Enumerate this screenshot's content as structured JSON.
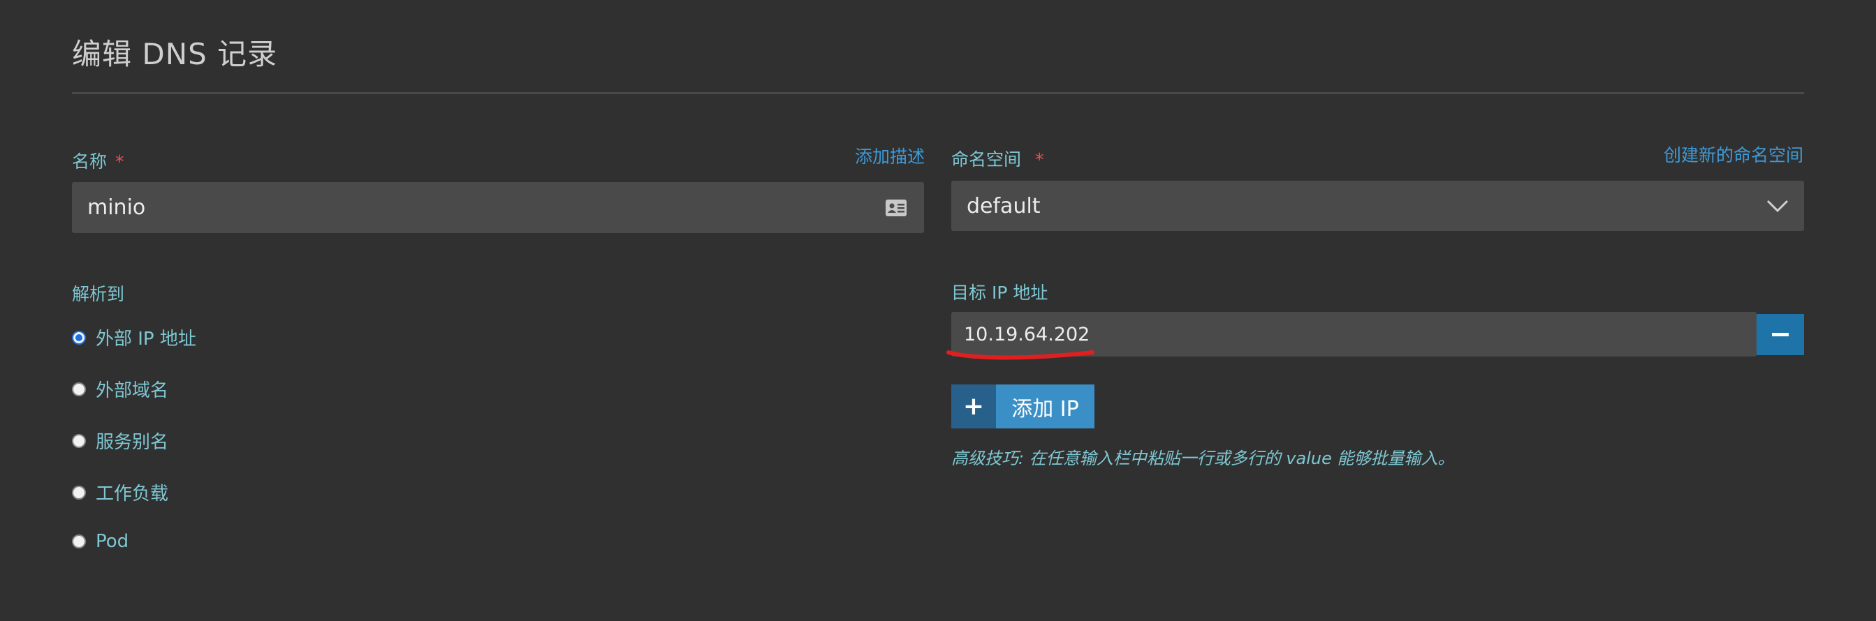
{
  "page": {
    "title": "编辑 DNS 记录"
  },
  "name_field": {
    "label": "名称",
    "required_mark": "*",
    "add_description_link": "添加描述",
    "value": "minio"
  },
  "namespace_field": {
    "label": "命名空间",
    "required_mark": "*",
    "create_link": "创建新的命名空间",
    "value": "default"
  },
  "resolve_to": {
    "label": "解析到",
    "options": [
      {
        "label": "外部 IP 地址",
        "checked": true
      },
      {
        "label": "外部域名",
        "checked": false
      },
      {
        "label": "服务别名",
        "checked": false
      },
      {
        "label": "工作负载",
        "checked": false
      },
      {
        "label": "Pod",
        "checked": false
      }
    ]
  },
  "target_ip": {
    "label": "目标 IP 地址",
    "value": "10.19.64.202",
    "add_button_label": "添加 IP",
    "tip": "高级技巧: 在任意输入栏中粘贴一行或多行的 value 能够批量输入。"
  },
  "colors": {
    "background": "#303030",
    "input_background": "#4a4a4a",
    "label": "#7ec8d3",
    "link": "#3d9ad8",
    "required": "#e4535a",
    "button_primary": "#3a8fc7",
    "button_dark": "#1e73a8",
    "annotation_underline": "#e02020"
  }
}
